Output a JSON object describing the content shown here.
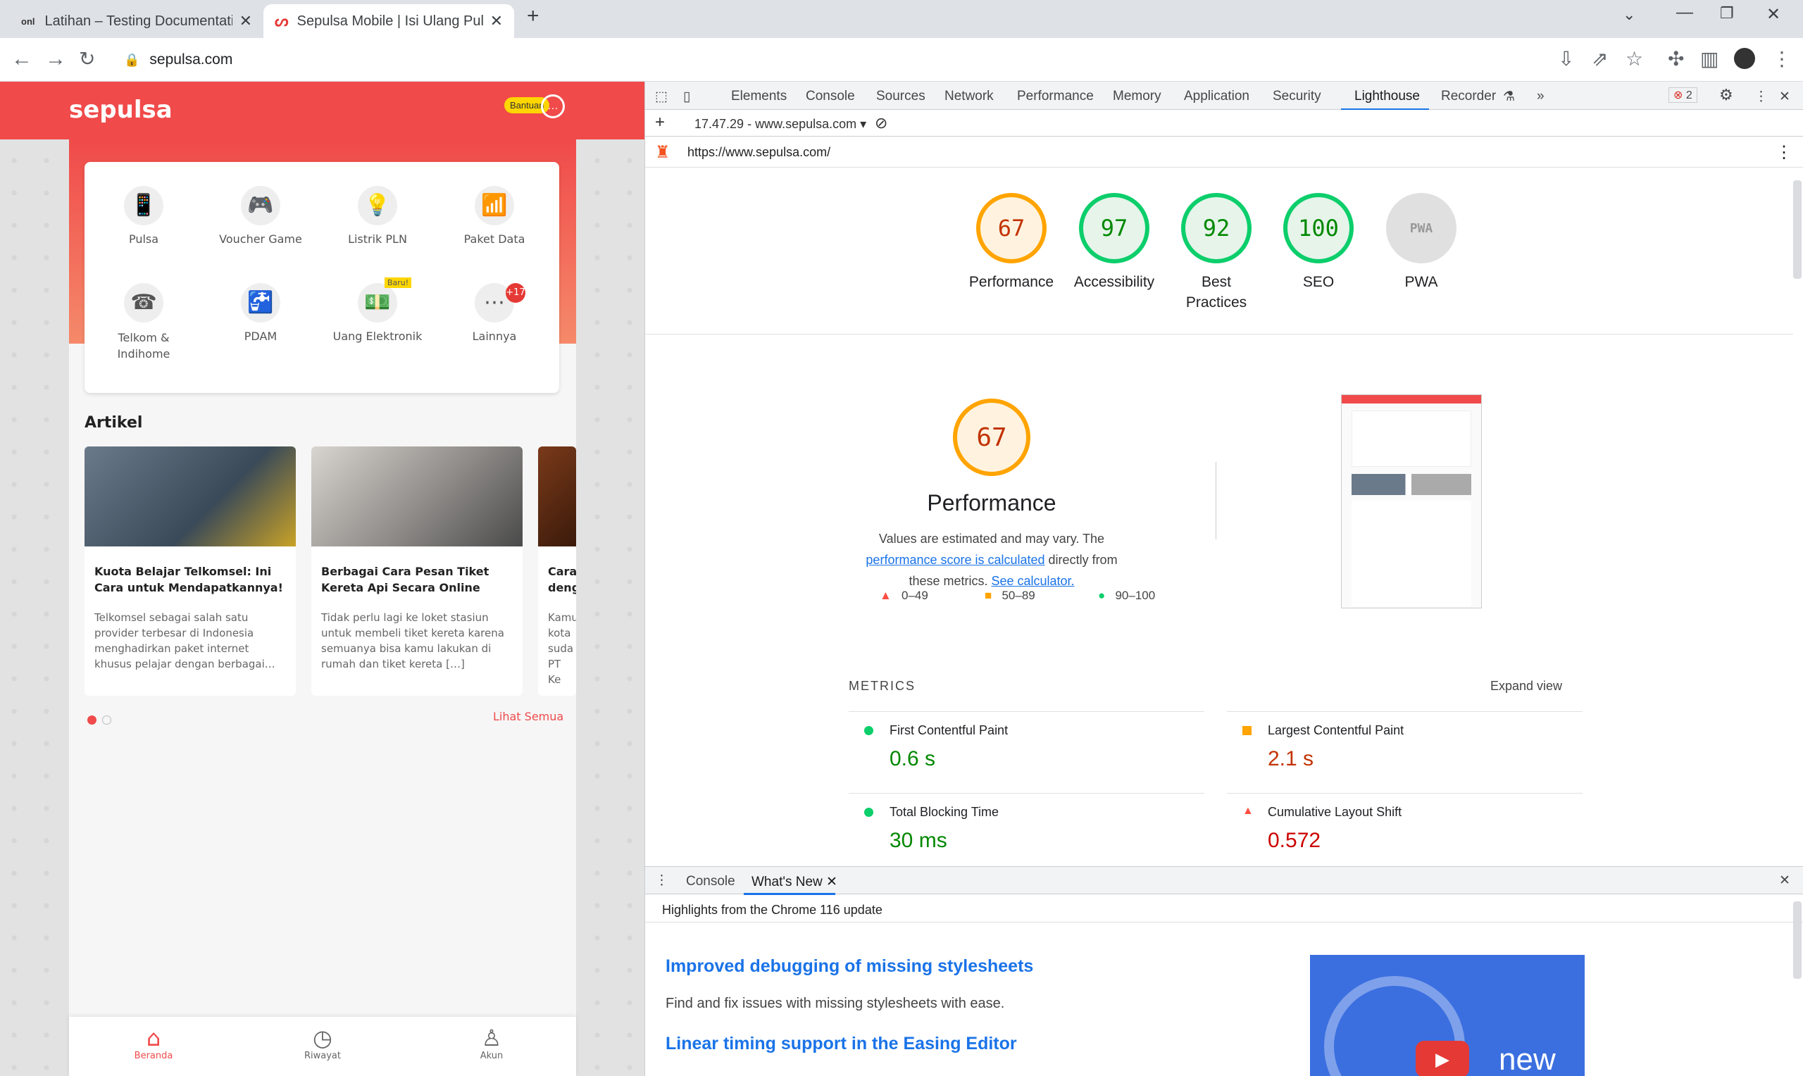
{
  "browser": {
    "tabs": [
      {
        "title": "Latihan – Testing Documentation",
        "icon": "onl"
      },
      {
        "title": "Sepulsa Mobile | Isi Ulang Pulsa S",
        "icon": "sepulsa-icon"
      }
    ],
    "url": "sepulsa.com"
  },
  "app": {
    "logo": "sepulsa",
    "help_label": "Bantuan",
    "services": [
      {
        "label": "Pulsa",
        "icon": "📱"
      },
      {
        "label": "Voucher Game",
        "icon": "🎮"
      },
      {
        "label": "Listrik PLN",
        "icon": "💡"
      },
      {
        "label": "Paket Data",
        "icon": "📶"
      },
      {
        "label": "Telkom & Indihome",
        "icon": "☎"
      },
      {
        "label": "PDAM",
        "icon": "🚰"
      },
      {
        "label": "Uang Elektronik",
        "icon": "💵"
      },
      {
        "label": "Lainnya",
        "icon": "⋯",
        "badge": "+17"
      }
    ],
    "new_badge": "Baru!",
    "articles_title": "Artikel",
    "articles": [
      {
        "title": "Kuota Belajar Telkomsel: Ini Cara untuk Mendapatkannya!",
        "desc": "Telkomsel sebagai salah satu provider terbesar di Indonesia menghadirkan paket internet khusus pelajar dengan berbagai…"
      },
      {
        "title": "Berbagai Cara Pesan Tiket Kereta Api Secara Online",
        "desc": "Tidak perlu lagi ke loket stasiun untuk membeli tiket kereta karena semuanya bisa kamu lakukan di rumah dan tiket kereta […]"
      },
      {
        "title": "Cara deng",
        "desc": "Kamu kota suda PT Ke"
      }
    ],
    "see_all": "Lihat Semua",
    "bottom_nav": [
      {
        "label": "Beranda",
        "icon": "⌂"
      },
      {
        "label": "Riwayat",
        "icon": "◷"
      },
      {
        "label": "Akun",
        "icon": "♙"
      }
    ]
  },
  "devtools": {
    "tabs": [
      "Elements",
      "Console",
      "Sources",
      "Network",
      "Performance",
      "Memory",
      "Application",
      "Security",
      "Lighthouse",
      "Recorder"
    ],
    "active_tab": "Lighthouse",
    "error_count": "2",
    "report_selector": "17.47.29 - www.sepulsa.com",
    "report_url": "https://www.sepulsa.com/",
    "scores": [
      {
        "label": "Performance",
        "value": "67",
        "level": "avg"
      },
      {
        "label": "Accessibility",
        "value": "97",
        "level": "good"
      },
      {
        "label": "Best Practices",
        "value": "92",
        "level": "good"
      },
      {
        "label": "SEO",
        "value": "100",
        "level": "good"
      },
      {
        "label": "PWA",
        "value": "PWA",
        "level": "na"
      }
    ],
    "performance": {
      "score": "67",
      "title": "Performance",
      "desc_prefix": "Values are estimated and may vary. The ",
      "link1": "performance score is calculated",
      "desc_mid": " directly from these metrics. ",
      "link2": "See calculator.",
      "legend": [
        "0–49",
        "50–89",
        "90–100"
      ]
    },
    "metrics_header": "METRICS",
    "expand_view": "Expand view",
    "metrics": [
      {
        "name": "First Contentful Paint",
        "value": "0.6 s",
        "status": "good"
      },
      {
        "name": "Largest Contentful Paint",
        "value": "2.1 s",
        "status": "avg"
      },
      {
        "name": "Total Blocking Time",
        "value": "30 ms",
        "status": "good"
      },
      {
        "name": "Cumulative Layout Shift",
        "value": "0.572",
        "status": "bad"
      }
    ],
    "drawer": {
      "tabs": [
        "Console",
        "What's New"
      ],
      "header": "Highlights from the Chrome 116 update",
      "items": [
        {
          "title": "Improved debugging of missing stylesheets",
          "desc": "Find and fix issues with missing stylesheets with ease."
        },
        {
          "title": "Linear timing support in the Easing Editor",
          "desc": ""
        }
      ],
      "video_label": "new"
    }
  },
  "colors": {
    "brand": "#f04a4a",
    "good": "#0cce6b",
    "average": "#ffa400",
    "bad": "#ff4e42",
    "link": "#1a73e8"
  }
}
